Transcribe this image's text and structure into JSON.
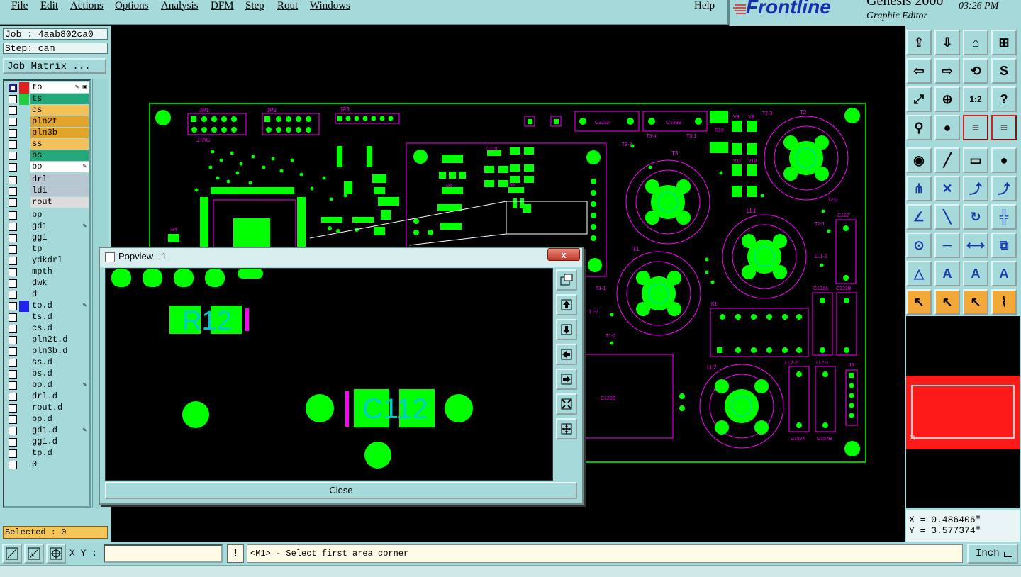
{
  "menu": [
    "File",
    "Edit",
    "Actions",
    "Options",
    "Analysis",
    "DFM",
    "Step",
    "Rout",
    "Windows"
  ],
  "help": "Help",
  "brand": {
    "logo": "Frontline",
    "title": "Genesis 2000",
    "subtitle": "Graphic Editor",
    "time": "03:26 PM"
  },
  "job": {
    "job": "Job : 4aab802ca0",
    "step": "Step: cam",
    "matrix_button": "Job Matrix ..."
  },
  "layers": [
    {
      "name": "to",
      "color": "#ffffff",
      "marker": "#e02020",
      "edit": "✎ ▣"
    },
    {
      "name": "ts",
      "color": "#23a87c",
      "marker": "#22cc44",
      "edit": ""
    },
    {
      "name": "cs",
      "color": "#f3c15a",
      "marker": "",
      "edit": ""
    },
    {
      "name": "pln2t",
      "color": "#e2a32a",
      "marker": "",
      "edit": ""
    },
    {
      "name": "pln3b",
      "color": "#e2a32a",
      "marker": "",
      "edit": ""
    },
    {
      "name": "ss",
      "color": "#f3c15a",
      "marker": "",
      "edit": ""
    },
    {
      "name": "bs",
      "color": "#23a87c",
      "marker": "",
      "edit": ""
    },
    {
      "name": "bo",
      "color": "#ffffff",
      "marker": "",
      "edit": "✎"
    },
    {
      "name": "drl",
      "color": "#b9c6d2",
      "marker": "",
      "edit": ""
    },
    {
      "name": "ldi",
      "color": "#b9c6d2",
      "marker": "",
      "edit": ""
    },
    {
      "name": "rout",
      "color": "#dcdcdc",
      "marker": "",
      "edit": ""
    },
    {
      "name": "bp",
      "color": "#a6dada",
      "marker": "",
      "edit": ""
    },
    {
      "name": "gd1",
      "color": "#a6dada",
      "marker": "",
      "edit": "✎"
    },
    {
      "name": "gg1",
      "color": "#a6dada",
      "marker": "",
      "edit": ""
    },
    {
      "name": "tp",
      "color": "#a6dada",
      "marker": "",
      "edit": ""
    },
    {
      "name": "ydkdrl",
      "color": "#a6dada",
      "marker": "",
      "edit": ""
    },
    {
      "name": "mpth",
      "color": "#a6dada",
      "marker": "",
      "edit": ""
    },
    {
      "name": "dwk",
      "color": "#a6dada",
      "marker": "",
      "edit": ""
    },
    {
      "name": "d",
      "color": "#a6dada",
      "marker": "",
      "edit": ""
    },
    {
      "name": "to.d",
      "color": "#a6dada",
      "marker": "#2222ee",
      "edit": "✎"
    },
    {
      "name": "ts.d",
      "color": "#a6dada",
      "marker": "",
      "edit": ""
    },
    {
      "name": "cs.d",
      "color": "#a6dada",
      "marker": "",
      "edit": ""
    },
    {
      "name": "pln2t.d",
      "color": "#a6dada",
      "marker": "",
      "edit": ""
    },
    {
      "name": "pln3b.d",
      "color": "#a6dada",
      "marker": "",
      "edit": ""
    },
    {
      "name": "ss.d",
      "color": "#a6dada",
      "marker": "",
      "edit": ""
    },
    {
      "name": "bs.d",
      "color": "#a6dada",
      "marker": "",
      "edit": ""
    },
    {
      "name": "bo.d",
      "color": "#a6dada",
      "marker": "",
      "edit": "✎"
    },
    {
      "name": "drl.d",
      "color": "#a6dada",
      "marker": "",
      "edit": ""
    },
    {
      "name": "rout.d",
      "color": "#a6dada",
      "marker": "",
      "edit": ""
    },
    {
      "name": "bp.d",
      "color": "#a6dada",
      "marker": "",
      "edit": ""
    },
    {
      "name": "gd1.d",
      "color": "#a6dada",
      "marker": "",
      "edit": "✎"
    },
    {
      "name": "gg1.d",
      "color": "#a6dada",
      "marker": "",
      "edit": ""
    },
    {
      "name": "tp.d",
      "color": "#a6dada",
      "marker": "",
      "edit": ""
    },
    {
      "name": "0",
      "color": "#a6dada",
      "marker": "",
      "edit": ""
    }
  ],
  "selected": "Selected : 0",
  "board_labels": {
    "jp1": "JP1",
    "jp2": "JP2",
    "jp3": "JP3",
    "jtag": "JTAG",
    "c123a": "C123A",
    "c123b": "C123B",
    "t1": "T1",
    "t2": "T2",
    "t3": "T3",
    "ll1": "LL1",
    "ll2": "LL2",
    "k1": "K1",
    "c122": "C122",
    "c121a": "C121A",
    "c121b": "C121B",
    "c157a": "C157A",
    "c157b": "C157B",
    "j5": "J5",
    "c120b": "C120B",
    "ll1_2": "LL1-2",
    "ll2_2": "LL2-2",
    "ll2_1": "LL2-1",
    "t2_1": "T2-1",
    "t2_2": "T2-2",
    "t2_3": "T2-3",
    "t3_3": "T3-3",
    "t3_4": "T3-4",
    "t3_1": "T3-1",
    "t1_1": "T1-1",
    "t1_2": "T1-2",
    "t1_3": "T1-3",
    "v9": "V9",
    "v8": "V8",
    "v11": "V11",
    "v10": "V10",
    "r10": "R10",
    "r4": "R4",
    "c110": "C110",
    "d6": "D6",
    "d5": "D5"
  },
  "popview": {
    "title": "Popview - 1",
    "close_x": "x",
    "close_button": "Close",
    "labels": {
      "r12": "R12",
      "c112": "C112"
    }
  },
  "coords": {
    "x": "X = 0.486406\"",
    "y": "Y = 3.577374\""
  },
  "bottom": {
    "xy_label": "X Y :",
    "xy_value": "",
    "excl": "!",
    "message": "<M1> - Select first area corner",
    "units": "Inch"
  },
  "colors": {
    "panel": "#a6dada",
    "copper": "#00ff00",
    "outline": "#ff00ff",
    "board_outline": "#00c000"
  }
}
